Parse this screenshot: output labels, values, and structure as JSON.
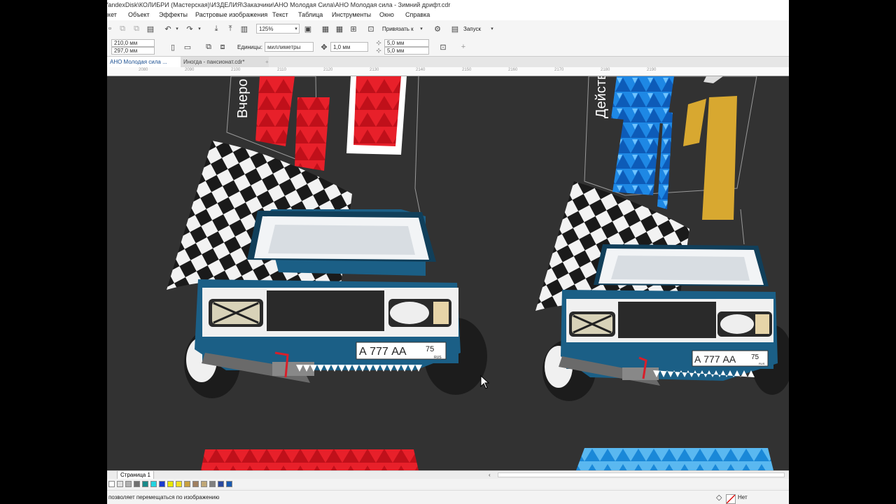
{
  "window": {
    "title": "YandexDisk\\КОЛИБРИ (Мастерская)\\ИЗДЕЛИЯ\\Заказчики\\АНО Молодая Сила\\АНО Молодая сила - Зимний дрифт.cdr"
  },
  "menu": [
    "йкет",
    "Объект",
    "Эффекты",
    "Растровые изображения",
    "Текст",
    "Таблица",
    "Инструменты",
    "Окно",
    "Справка"
  ],
  "toolbar": {
    "zoom": "125%",
    "snap_label": "Привязать к",
    "launch_label": "Запуск"
  },
  "propertybar": {
    "width": "210,0 мм",
    "height": "297,0 мм",
    "units_label": "Единицы:",
    "units_value": "миллиметры",
    "nudge": "1,0 мм",
    "dup_x": "5,0 мм",
    "dup_y": "5,0 мм"
  },
  "tabs": [
    {
      "label": "АНО Молодая сила ...",
      "active": true
    },
    {
      "label": "Иногда - пансионат.cdr*",
      "active": false
    }
  ],
  "ruler_ticks": [
    "2080",
    "2090",
    "2100",
    "2110",
    "2120",
    "2130",
    "2140",
    "2150",
    "2160",
    "2170",
    "2180",
    "2190"
  ],
  "page_tab": "Страница 1",
  "palette_colors": [
    "#ffffff",
    "#e0e0e0",
    "#b0b0b0",
    "#707070",
    "#1a8a8a",
    "#22d4e0",
    "#1a3ad0",
    "#e8e800",
    "#f0e020",
    "#c8a040",
    "#a08060",
    "#c0a878",
    "#808080",
    "#2a4aa0",
    "#1a5ab0"
  ],
  "status": {
    "hint": "позволяет перемещаться по изображению",
    "fill_label": "Нет"
  },
  "artwork": {
    "left_side_text": "Вчеро",
    "right_side_text": "Действ",
    "plate_text": "А 777 АА",
    "plate_region": "75",
    "plate_country": "RUS",
    "brand_colors": {
      "red": "#e8202a",
      "blue": "#1a7ad8",
      "gold": "#d8a830",
      "car": "#1b5f86"
    }
  }
}
